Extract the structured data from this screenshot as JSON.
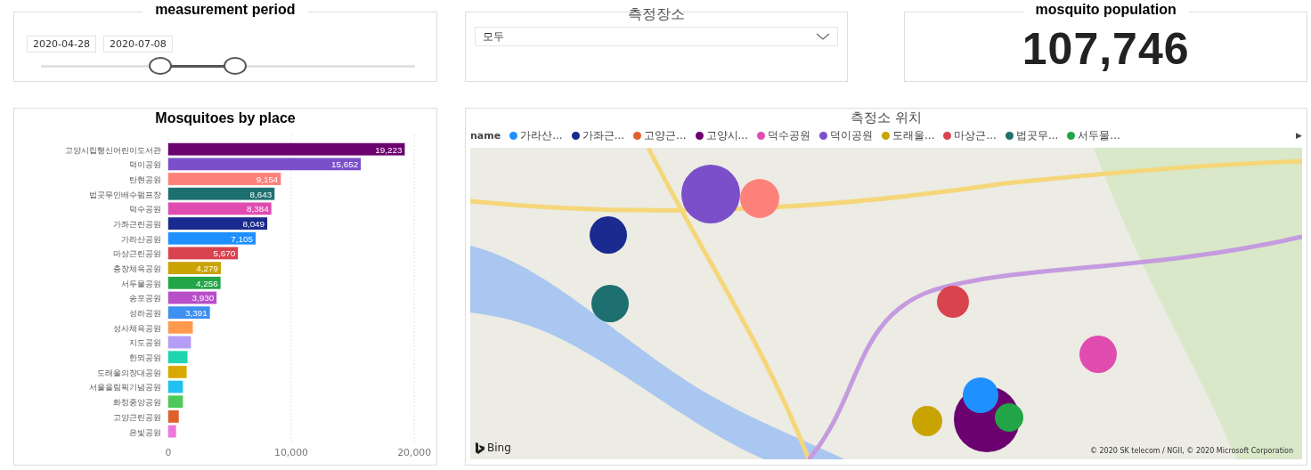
{
  "period": {
    "title": "measurement period",
    "dates": [
      "2020-04-28",
      "2020-07-08"
    ],
    "thumbs": [
      {
        "level": 0.32
      },
      {
        "level": 0.52
      }
    ]
  },
  "place_filter": {
    "label": "측정장소",
    "value": "모두"
  },
  "population": {
    "title": "mosquito population",
    "value": "107,746"
  },
  "bar_card": {
    "title": "Mosquitoes by place",
    "bar_colors": [
      {
        "color": "#6b006f"
      },
      {
        "color": "#7b4fc9"
      },
      {
        "color": "#fd817a"
      },
      {
        "color": "#1e6f6f"
      },
      {
        "color": "#e04cb0"
      },
      {
        "color": "#1a2a8f"
      },
      {
        "color": "#1e90ff"
      },
      {
        "color": "#d9434e"
      },
      {
        "color": "#c9a300"
      },
      {
        "color": "#22a546"
      },
      {
        "color": "#b84fc9"
      },
      {
        "color": "#3d8ff0"
      },
      {
        "color": "#ff9a4d"
      },
      {
        "color": "#b59cf5"
      },
      {
        "color": "#20d4b0"
      },
      {
        "color": "#d9a900"
      },
      {
        "color": "#20c0f0"
      },
      {
        "color": "#4cc95a"
      },
      {
        "color": "#e0602a"
      },
      {
        "color": "#ee77dd"
      }
    ],
    "chart_data": {
      "type": "bar",
      "orientation": "horizontal",
      "categories": [
        "고양시립행신어린이도서관",
        "덕이공원",
        "탄현공원",
        "법곳무인배수펌프장",
        "덕수공원",
        "가좌근린공원",
        "가라산공원",
        "마상근린공원",
        "충장체육공원",
        "서두물공원",
        "송포공원",
        "성라공원",
        "성사체육공원",
        "지도공원",
        "한뫼공원",
        "도래울의장대공원",
        "서울올림픽기념공원",
        "화정중앙공원",
        "고양근린공원",
        "은빛공원"
      ],
      "values": [
        19223,
        15652,
        9154,
        8643,
        8384,
        8049,
        7105,
        5670,
        4279,
        4256,
        3930,
        3391,
        2000,
        1850,
        1570,
        1500,
        1200,
        1200,
        860,
        640
      ],
      "value_labels": [
        "19,223",
        "15,652",
        "9,154",
        "8,643",
        "8,384",
        "8,049",
        "7,105",
        "5,670",
        "4,279",
        "4,256",
        "3,930",
        "3,391",
        null,
        null,
        null,
        null,
        null,
        null,
        null,
        null
      ],
      "xlim": [
        0,
        20000
      ],
      "xticks": [
        {
          "value": 0,
          "label": "0"
        },
        {
          "value": 10000,
          "label": "10,000"
        },
        {
          "value": 20000,
          "label": "20,000"
        }
      ]
    }
  },
  "map_card": {
    "title": "측정소 위치",
    "legend_title": "name",
    "legend": [
      {
        "label": "가라산...",
        "color": "#1e90ff"
      },
      {
        "label": "가좌근...",
        "color": "#1a2a8f"
      },
      {
        "label": "고양근...",
        "color": "#e0602a"
      },
      {
        "label": "고양시...",
        "color": "#6b006f"
      },
      {
        "label": "덕수공원",
        "color": "#e04cb0"
      },
      {
        "label": "덕이공원",
        "color": "#7b4fc9"
      },
      {
        "label": "도래울...",
        "color": "#c9a300"
      },
      {
        "label": "마상근...",
        "color": "#d9434e"
      },
      {
        "label": "법곳무...",
        "color": "#1e6f6f"
      },
      {
        "label": "서두물...",
        "color": "#22a546"
      }
    ],
    "legend_more": "▶",
    "logo": "Bing",
    "copyright": "© 2020 SK telecom / NGII, © 2020 Microsoft Corporation"
  }
}
